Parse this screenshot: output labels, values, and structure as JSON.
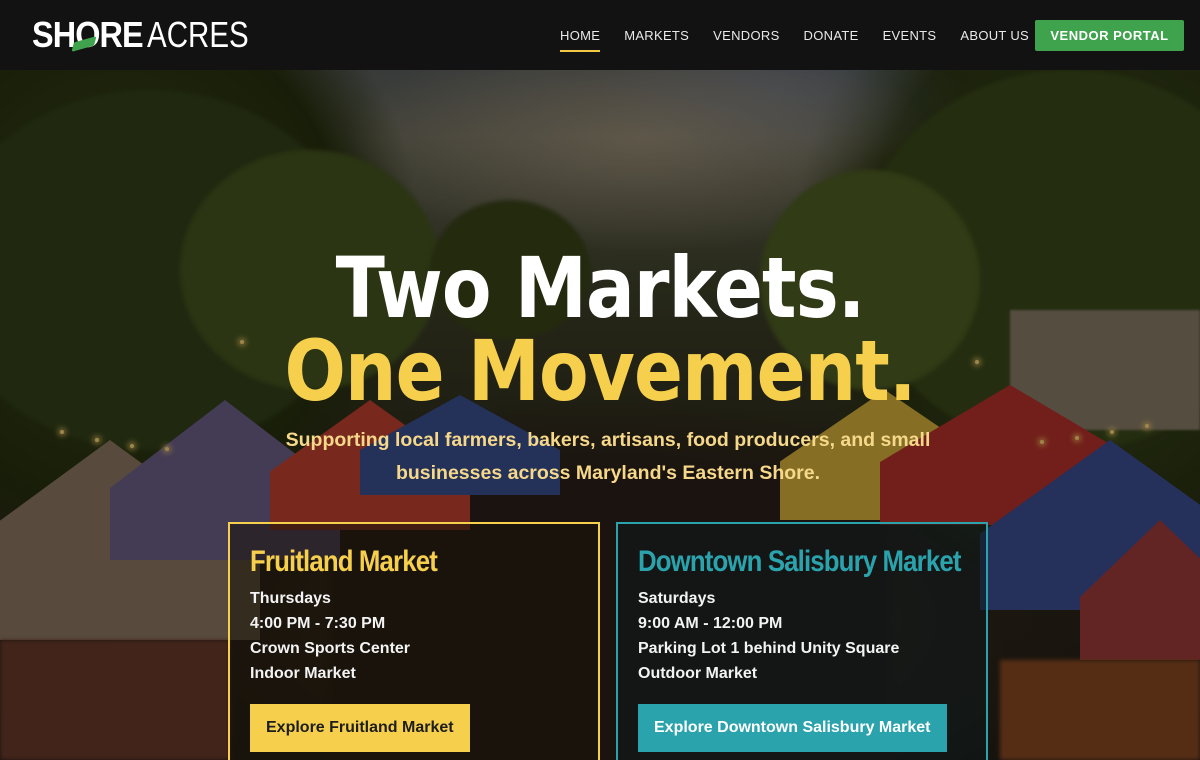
{
  "brand": {
    "logo_part1": "SHORE",
    "logo_part2": "ACRES",
    "accent_green": "#3fa34d",
    "accent_yellow": "#f6d04d",
    "accent_teal": "#2aa3ad"
  },
  "nav": {
    "links": [
      {
        "label": "HOME",
        "active": true
      },
      {
        "label": "MARKETS",
        "active": false
      },
      {
        "label": "VENDORS",
        "active": false
      },
      {
        "label": "DONATE",
        "active": false
      },
      {
        "label": "EVENTS",
        "active": false
      },
      {
        "label": "ABOUT US",
        "active": false
      }
    ],
    "portal_label": "VENDOR PORTAL"
  },
  "hero": {
    "headline_line1": "Two Markets.",
    "headline_line2": "One Movement.",
    "subtitle": "Supporting local farmers, bakers, artisans, food producers, and small businesses across Maryland's Eastern Shore."
  },
  "markets": [
    {
      "name": "Fruitland Market",
      "day": "Thursdays",
      "hours": "4:00 PM - 7:30 PM",
      "location": "Crown Sports Center",
      "type": "Indoor Market",
      "button_label": "Explore Fruitland Market"
    },
    {
      "name": "Downtown Salisbury Market",
      "day": "Saturdays",
      "hours": "9:00 AM - 12:00 PM",
      "location": "Parking Lot 1 behind Unity Square",
      "type": "Outdoor Market",
      "button_label": "Explore Downtown Salisbury Market"
    }
  ]
}
